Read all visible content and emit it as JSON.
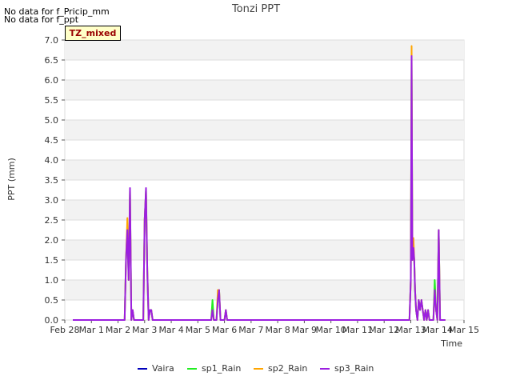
{
  "messages": [
    "No data for f_Pricip_mm",
    "No data for f_ppt"
  ],
  "badge": "TZ_mixed",
  "chart_data": {
    "type": "line",
    "title": "Tonzi PPT",
    "xlabel": "Time",
    "ylabel": "PPT (mm)",
    "xlim": [
      0,
      15
    ],
    "ylim": [
      0,
      7.0
    ],
    "x_ticks": [
      0,
      1,
      2,
      3,
      4,
      5,
      6,
      7,
      8,
      9,
      10,
      11,
      12,
      13,
      14,
      15
    ],
    "x_tick_labels": [
      "Feb 28",
      "Mar 1",
      "Mar 2",
      "Mar 3",
      "Mar 4",
      "Mar 5",
      "Mar 6",
      "Mar 7",
      "Mar 8",
      "Mar 9",
      "Mar 10",
      "Mar 11",
      "Mar 12",
      "Mar 13",
      "Mar 14",
      "Mar 15"
    ],
    "y_ticks": [
      0.0,
      0.5,
      1.0,
      1.5,
      2.0,
      2.5,
      3.0,
      3.5,
      4.0,
      4.5,
      5.0,
      5.5,
      6.0,
      6.5,
      7.0
    ],
    "y_tick_labels": [
      "0.0",
      "0.5",
      "1.0",
      "1.5",
      "2.0",
      "2.5",
      "3.0",
      "3.5",
      "4.0",
      "4.5",
      "5.0",
      "5.5",
      "6.0",
      "6.5",
      "7.0"
    ],
    "grid": "horizontal bands",
    "legend_position": "bottom",
    "series": [
      {
        "name": "Vaira",
        "color": "#0000bb",
        "points": []
      },
      {
        "name": "sp1_Rain",
        "color": "#22ee22",
        "points": [
          [
            0.3,
            0
          ],
          [
            2.25,
            0
          ],
          [
            2.3,
            1.5
          ],
          [
            2.35,
            2.3
          ],
          [
            2.4,
            1.0
          ],
          [
            2.45,
            3.25
          ],
          [
            2.5,
            0
          ],
          [
            2.55,
            0.25
          ],
          [
            2.6,
            0
          ],
          [
            2.95,
            0
          ],
          [
            3.0,
            2.5
          ],
          [
            3.05,
            3.25
          ],
          [
            3.1,
            1.25
          ],
          [
            3.15,
            0
          ],
          [
            3.2,
            0.25
          ],
          [
            3.25,
            0.25
          ],
          [
            3.3,
            0
          ],
          [
            5.5,
            0
          ],
          [
            5.55,
            0.5
          ],
          [
            5.6,
            0
          ],
          [
            5.7,
            0
          ],
          [
            5.75,
            0.5
          ],
          [
            5.8,
            0.75
          ],
          [
            5.85,
            0
          ],
          [
            6.0,
            0
          ],
          [
            6.05,
            0.25
          ],
          [
            6.1,
            0
          ],
          [
            12.95,
            0
          ],
          [
            13.0,
            1.0
          ],
          [
            13.03,
            6.5
          ],
          [
            13.06,
            1.5
          ],
          [
            13.1,
            1.75
          ],
          [
            13.13,
            1.5
          ],
          [
            13.16,
            0.75
          ],
          [
            13.2,
            0.25
          ],
          [
            13.25,
            0
          ],
          [
            13.3,
            0.5
          ],
          [
            13.35,
            0.25
          ],
          [
            13.4,
            0.5
          ],
          [
            13.45,
            0.25
          ],
          [
            13.5,
            0
          ],
          [
            13.55,
            0.25
          ],
          [
            13.6,
            0
          ],
          [
            13.65,
            0.25
          ],
          [
            13.7,
            0
          ],
          [
            13.85,
            0
          ],
          [
            13.9,
            1.0
          ],
          [
            13.95,
            0.25
          ],
          [
            14.0,
            0
          ],
          [
            14.05,
            2.25
          ],
          [
            14.1,
            0
          ],
          [
            14.3,
            0
          ]
        ]
      },
      {
        "name": "sp2_Rain",
        "color": "#ffa500",
        "points": [
          [
            0.3,
            0
          ],
          [
            2.25,
            0
          ],
          [
            2.3,
            1.5
          ],
          [
            2.35,
            2.55
          ],
          [
            2.4,
            1.0
          ],
          [
            2.45,
            3.25
          ],
          [
            2.5,
            0
          ],
          [
            2.55,
            0.25
          ],
          [
            2.6,
            0
          ],
          [
            2.95,
            0
          ],
          [
            3.0,
            2.5
          ],
          [
            3.05,
            3.25
          ],
          [
            3.1,
            1.25
          ],
          [
            3.15,
            0
          ],
          [
            3.2,
            0.25
          ],
          [
            3.25,
            0.25
          ],
          [
            3.3,
            0
          ],
          [
            5.5,
            0
          ],
          [
            5.55,
            0.25
          ],
          [
            5.6,
            0
          ],
          [
            5.7,
            0
          ],
          [
            5.75,
            0.75
          ],
          [
            5.8,
            0.75
          ],
          [
            5.85,
            0
          ],
          [
            6.0,
            0
          ],
          [
            6.05,
            0.25
          ],
          [
            6.1,
            0
          ],
          [
            12.95,
            0
          ],
          [
            13.0,
            1.0
          ],
          [
            13.03,
            6.85
          ],
          [
            13.06,
            1.5
          ],
          [
            13.1,
            2.05
          ],
          [
            13.13,
            1.5
          ],
          [
            13.16,
            0.75
          ],
          [
            13.2,
            0.25
          ],
          [
            13.25,
            0
          ],
          [
            13.3,
            0.5
          ],
          [
            13.35,
            0.25
          ],
          [
            13.4,
            0.5
          ],
          [
            13.45,
            0.25
          ],
          [
            13.5,
            0
          ],
          [
            13.55,
            0.25
          ],
          [
            13.6,
            0
          ],
          [
            13.65,
            0.25
          ],
          [
            13.7,
            0
          ],
          [
            13.85,
            0
          ],
          [
            13.9,
            0.75
          ],
          [
            13.95,
            0.25
          ],
          [
            14.0,
            0
          ],
          [
            14.05,
            2.25
          ],
          [
            14.1,
            0
          ],
          [
            14.3,
            0
          ]
        ]
      },
      {
        "name": "sp3_Rain",
        "color": "#9b1fe0",
        "points": [
          [
            0.3,
            0
          ],
          [
            2.25,
            0
          ],
          [
            2.3,
            1.5
          ],
          [
            2.35,
            2.25
          ],
          [
            2.4,
            1.0
          ],
          [
            2.45,
            3.3
          ],
          [
            2.5,
            0
          ],
          [
            2.55,
            0.25
          ],
          [
            2.6,
            0
          ],
          [
            2.95,
            0
          ],
          [
            3.0,
            2.5
          ],
          [
            3.05,
            3.3
          ],
          [
            3.1,
            1.25
          ],
          [
            3.15,
            0
          ],
          [
            3.2,
            0.25
          ],
          [
            3.25,
            0.25
          ],
          [
            3.3,
            0
          ],
          [
            5.5,
            0
          ],
          [
            5.55,
            0.25
          ],
          [
            5.6,
            0
          ],
          [
            5.7,
            0
          ],
          [
            5.75,
            0.5
          ],
          [
            5.8,
            0.75
          ],
          [
            5.85,
            0
          ],
          [
            6.0,
            0
          ],
          [
            6.05,
            0.25
          ],
          [
            6.1,
            0
          ],
          [
            12.95,
            0
          ],
          [
            13.0,
            1.0
          ],
          [
            13.03,
            6.6
          ],
          [
            13.06,
            1.5
          ],
          [
            13.1,
            1.8
          ],
          [
            13.13,
            1.5
          ],
          [
            13.16,
            0.75
          ],
          [
            13.2,
            0.25
          ],
          [
            13.25,
            0
          ],
          [
            13.3,
            0.5
          ],
          [
            13.35,
            0.25
          ],
          [
            13.4,
            0.5
          ],
          [
            13.45,
            0.25
          ],
          [
            13.5,
            0
          ],
          [
            13.55,
            0.25
          ],
          [
            13.6,
            0
          ],
          [
            13.65,
            0.25
          ],
          [
            13.7,
            0
          ],
          [
            13.85,
            0
          ],
          [
            13.9,
            0.75
          ],
          [
            13.95,
            0.25
          ],
          [
            14.0,
            0
          ],
          [
            14.05,
            2.25
          ],
          [
            14.1,
            0
          ],
          [
            14.3,
            0
          ]
        ]
      }
    ]
  }
}
